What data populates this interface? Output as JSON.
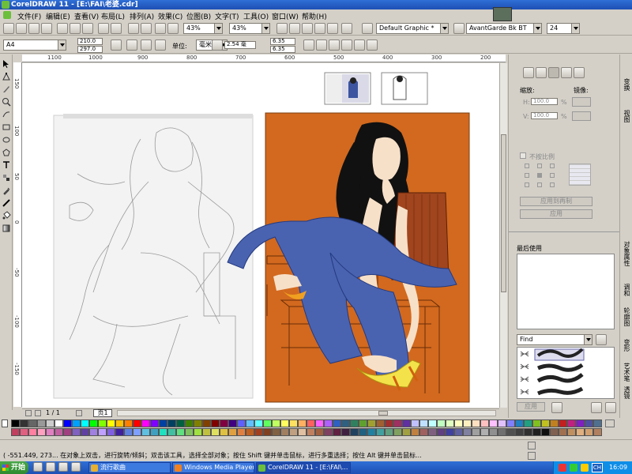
{
  "window": {
    "title": "CorelDRAW 11 - [E:\\FAI\\老婆.cdr]"
  },
  "menu": [
    {
      "label": "文件(F)"
    },
    {
      "label": "编辑(E)"
    },
    {
      "label": "查看(V)"
    },
    {
      "label": "布局(L)"
    },
    {
      "label": "排列(A)"
    },
    {
      "label": "效果(C)"
    },
    {
      "label": "位图(B)"
    },
    {
      "label": "文字(T)"
    },
    {
      "label": "工具(O)"
    },
    {
      "label": "窗口(W)"
    },
    {
      "label": "帮助(H)"
    }
  ],
  "toolbar": {
    "zoom1": "43%",
    "zoom2": "43%",
    "style": "Default Graphic *",
    "font": "AvantGarde Bk BT",
    "fontsize": "24"
  },
  "property_bar": {
    "page_size": "A4",
    "width": "210.0",
    "height": "297.0",
    "units_label": "单位:",
    "units": "毫米",
    "nudge": "2.54 毫",
    "dup_x": "6.35",
    "dup_y": "6.35"
  },
  "ruler": {
    "top_ticks": [
      "1100",
      "1000",
      "900",
      "800",
      "700",
      "600",
      "500",
      "400",
      "300",
      "200"
    ],
    "left_ticks": [
      "150",
      "100",
      "50",
      "0",
      "-50",
      "-100",
      "-150"
    ]
  },
  "page_nav": {
    "info": "1 / 1",
    "tab": "页1"
  },
  "docker": {
    "tab_transform": "变换",
    "tab_view": "视图",
    "scale_label": "缩放:",
    "mirror_label": "镜像:",
    "h_label": "H:",
    "h_value": "100.0",
    "v_label": "V:",
    "v_value": "100.0",
    "pct": "%",
    "proportional": "不按比例",
    "apply_dup": "应用到再制",
    "apply": "应用",
    "recent_title": "最后使用",
    "find": "Find",
    "apply2": "应用",
    "vtabs": [
      "对象属性",
      "调和",
      "轮廓图",
      "艺术笔",
      "变形",
      "透镜"
    ]
  },
  "status": {
    "coords": "( -551.449, 273... 在对象上双击，进行旋转/倾斜；双击该工具，选择全部对象；按住 Shift 键并单击鼠标，进行多重选择；按住 Alt 键并单击鼠标..."
  },
  "taskbar": {
    "start": "开始",
    "tasks": [
      {
        "label": "流行歌曲"
      },
      {
        "label": "Windows Media Player"
      },
      {
        "label": "CorelDRAW 11 - [E:\\FAI\\..."
      }
    ],
    "lang": "CH",
    "time": "16:09"
  },
  "palette_row1": [
    "#000000",
    "#333333",
    "#666666",
    "#999999",
    "#cccccc",
    "#ffffff",
    "#0000ff",
    "#00a0ff",
    "#00ffff",
    "#00ff00",
    "#80ff00",
    "#ffff00",
    "#ffc000",
    "#ff8000",
    "#ff0000",
    "#ff00ff",
    "#8000ff",
    "#0040a0",
    "#004060",
    "#006040",
    "#408000",
    "#808000",
    "#804000",
    "#800000",
    "#800040",
    "#400080",
    "#6060ff",
    "#60c0ff",
    "#60ffff",
    "#60ff60",
    "#c0ff60",
    "#ffff60",
    "#ffe060",
    "#ffb060",
    "#ff6060",
    "#ff60ff",
    "#b060ff",
    "#3060c0",
    "#306080",
    "#308060",
    "#60a030",
    "#a0a030",
    "#a06030",
    "#a03030",
    "#a03060",
    "#6030a0",
    "#c0c0ff",
    "#c0e0ff",
    "#c0ffff",
    "#c0ffc0",
    "#e0ffc0",
    "#ffffc0",
    "#fff0c0",
    "#ffe0c0",
    "#ffc0c0",
    "#ffc0ff",
    "#e0c0ff",
    "#8080ff",
    "#2080c0",
    "#20a080",
    "#80c020",
    "#c0c020",
    "#c08020",
    "#c02020",
    "#c02080",
    "#8020c0",
    "#5050a0",
    "#507090"
  ],
  "palette_row2": [
    "#c04060",
    "#e06080",
    "#ff80a0",
    "#ffa0c0",
    "#e080c0",
    "#c060a0",
    "#a04080",
    "#8060c0",
    "#6040a0",
    "#a080e0",
    "#c0a0ff",
    "#8060e0",
    "#4020a0",
    "#6080e0",
    "#80a0ff",
    "#60c0e0",
    "#40a0c0",
    "#20e0c0",
    "#40c0a0",
    "#60e080",
    "#80c060",
    "#a0e040",
    "#c0c040",
    "#e0e060",
    "#e0c040",
    "#e0a040",
    "#e08040",
    "#c06020",
    "#a04020",
    "#804020",
    "#806040",
    "#a08060",
    "#c0a080",
    "#e0c0a0",
    "#c08060",
    "#a06040",
    "#804060",
    "#602040",
    "#402040",
    "#204060",
    "#206080",
    "#2080a0",
    "#40a0a0",
    "#60a080",
    "#80a060",
    "#a0a040",
    "#c08040",
    "#a06060",
    "#806080",
    "#604080",
    "#4040a0",
    "#6060a0",
    "#8080a0",
    "#a0a0a0",
    "#b0b0b0",
    "#909090",
    "#707070",
    "#505050",
    "#404040",
    "#303030",
    "#202020",
    "#101010",
    "#806050",
    "#a07050",
    "#c09060",
    "#e0b080",
    "#d0a070",
    "#b08060"
  ]
}
